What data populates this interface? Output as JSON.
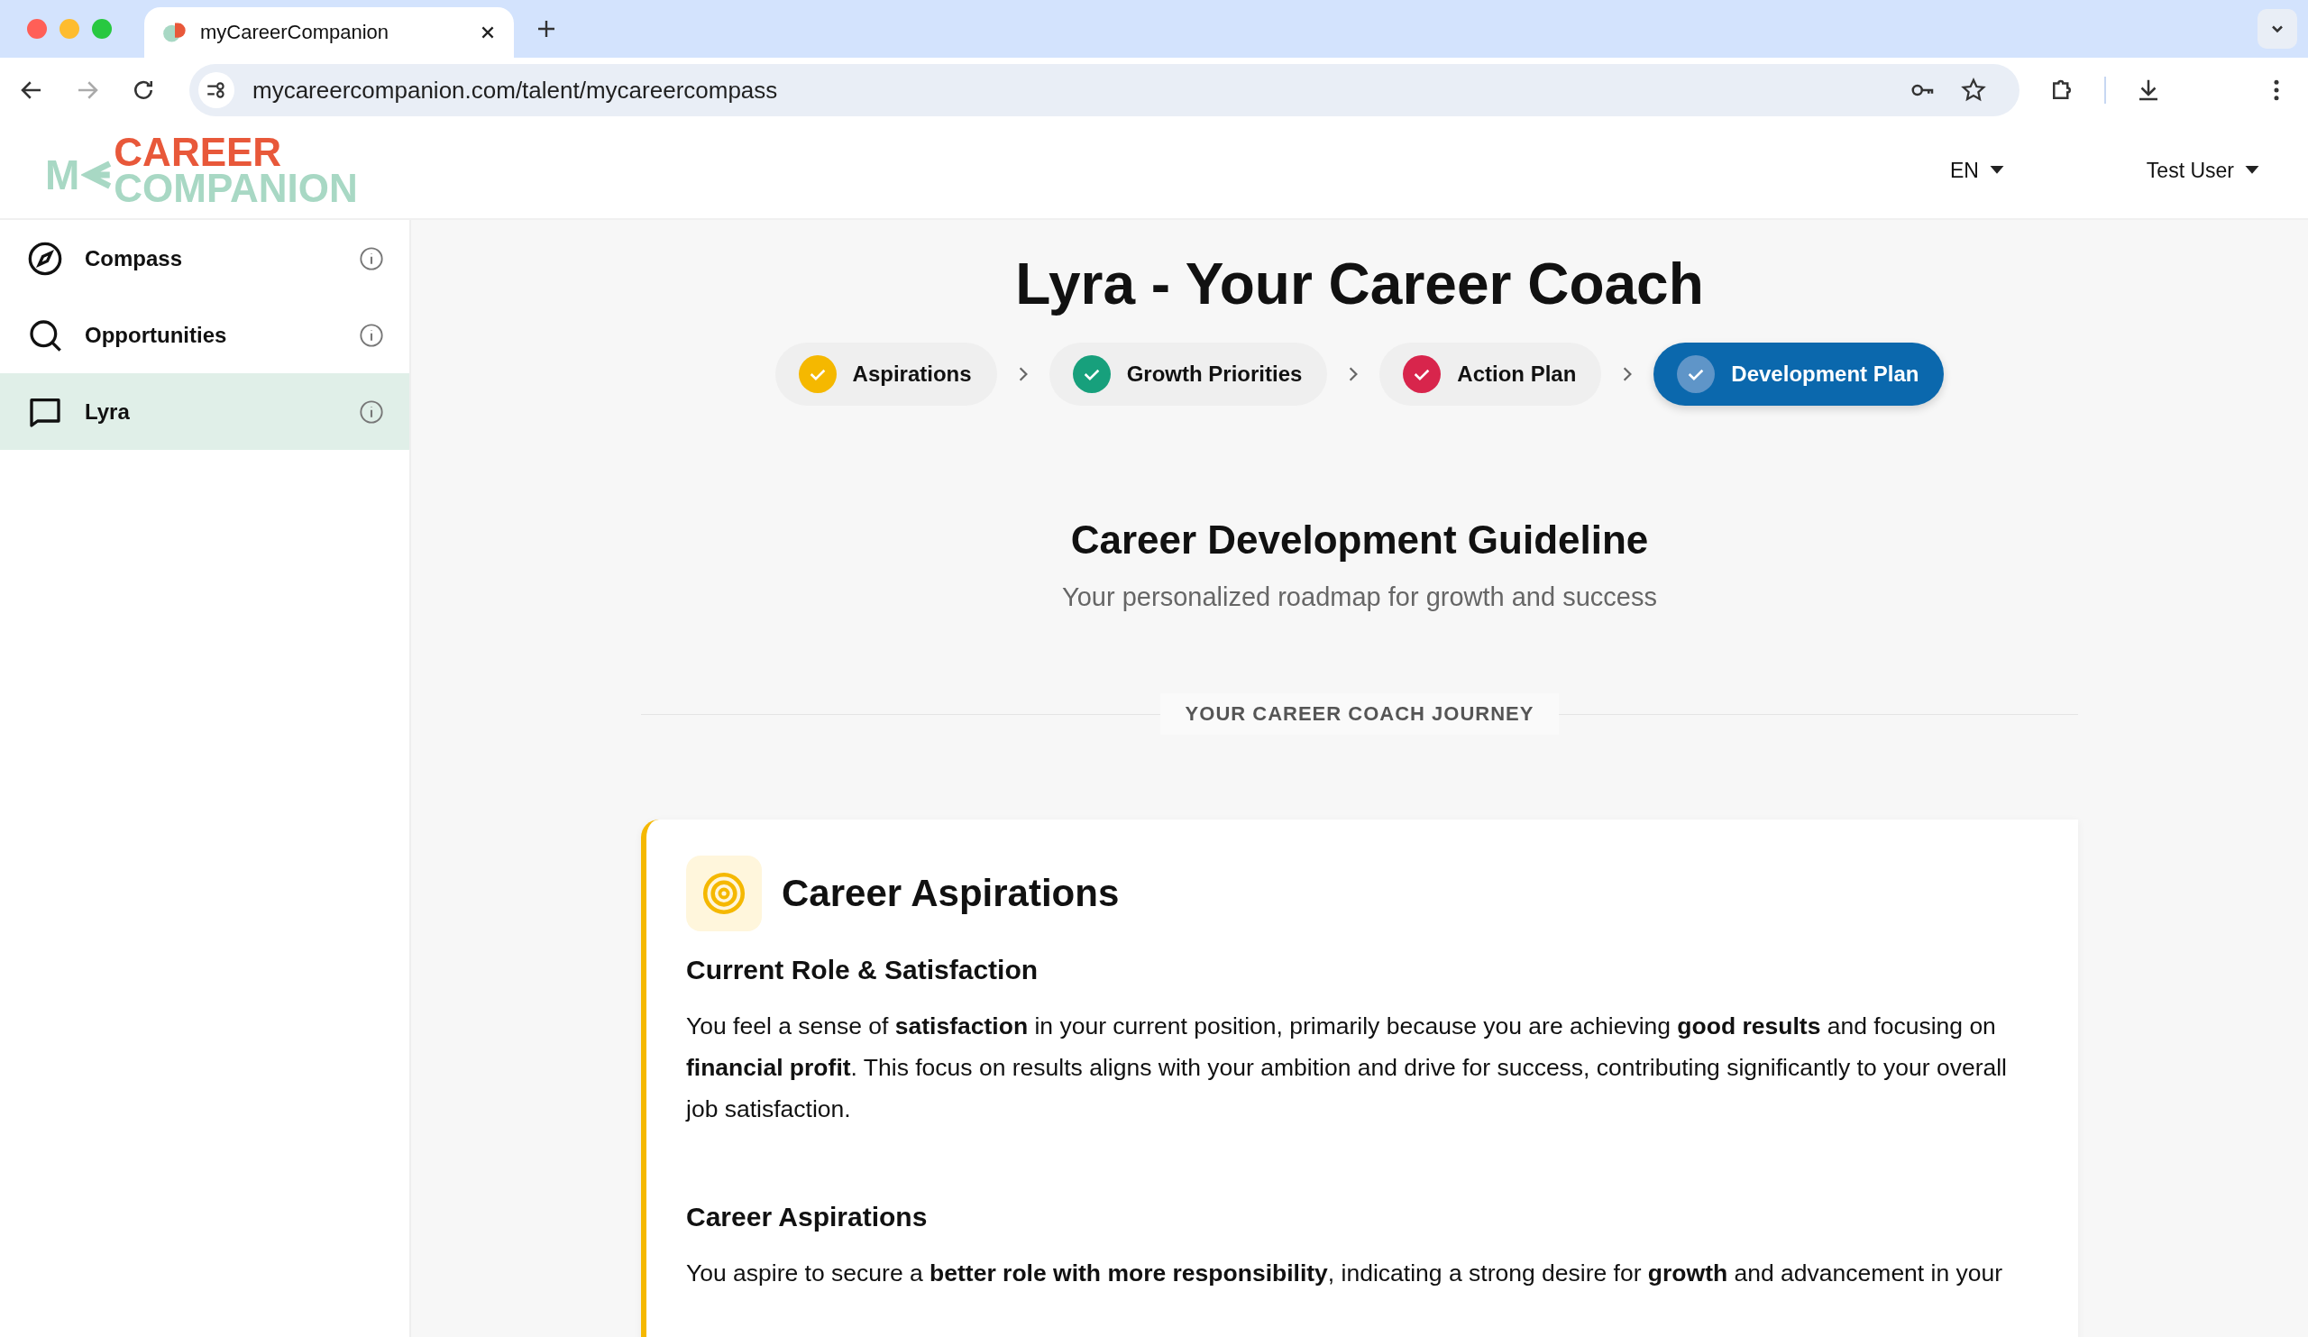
{
  "browser": {
    "tab_title": "myCareerCompanion",
    "url": "mycareercompanion.com/talent/mycareercompass"
  },
  "header": {
    "logo": {
      "prefix": "M",
      "line_1": "CAREER",
      "line_2": "COMPANION"
    },
    "language": "EN",
    "user": "Test User"
  },
  "sidebar": {
    "items": [
      {
        "label": "Compass",
        "kind": "compass",
        "selected": false
      },
      {
        "label": "Opportunities",
        "kind": "search",
        "selected": false
      },
      {
        "label": "Lyra",
        "kind": "chat",
        "selected": true
      }
    ]
  },
  "main": {
    "title": "Lyra - Your Career Coach",
    "steps": [
      {
        "label": "Aspirations",
        "color": "#f5b800",
        "selected": false
      },
      {
        "label": "Growth Priorities",
        "color": "#17a07c",
        "selected": false
      },
      {
        "label": "Action Plan",
        "color": "#d8254c",
        "selected": false
      },
      {
        "label": "Development Plan",
        "color": "#5f95c8",
        "selected": true
      }
    ],
    "guideline_title": "Career Development Guideline",
    "guideline_subtitle": "Your personalized roadmap for growth and success",
    "divider_label": "YOUR CAREER COACH JOURNEY",
    "card": {
      "title": "Career Aspirations",
      "sections": [
        {
          "heading": "Current Role & Satisfaction",
          "text": "You feel a sense of **satisfaction** in your current position, primarily because you are achieving **good results** and focusing on **financial profit**. This focus on results aligns with your ambition and drive for success, contributing significantly to your overall job satisfaction."
        },
        {
          "heading": "Career Aspirations",
          "text": "You aspire to secure a **better role with more responsibility**, indicating a strong desire for **growth** and advancement in your"
        }
      ]
    }
  }
}
